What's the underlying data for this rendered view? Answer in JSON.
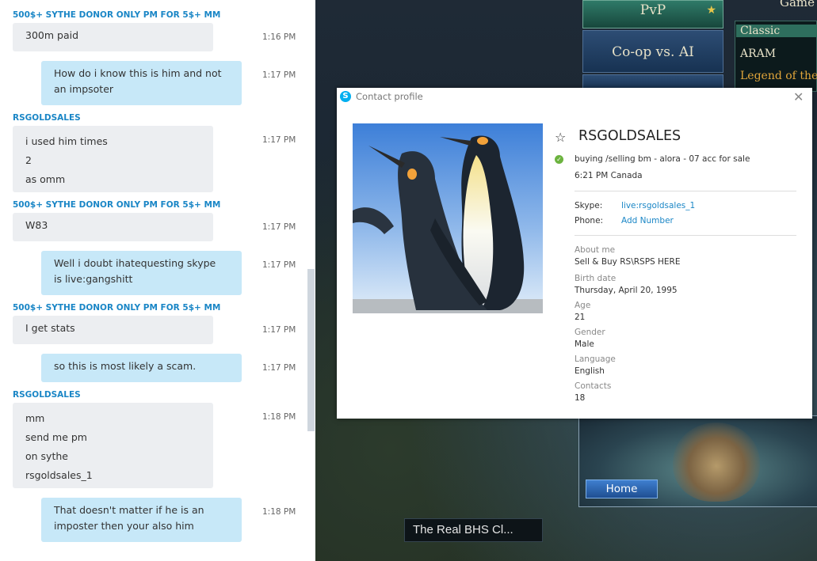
{
  "chat": {
    "messages": [
      {
        "sender": "500$+ SYTHE DONOR ONLY PM FOR 5$+ MM"
      },
      {
        "dir": "in",
        "lines": [
          "300m paid"
        ],
        "time": "1:16 PM"
      },
      {
        "dir": "out",
        "lines": [
          "How do i know this is him and not",
          "an impsoter"
        ],
        "time": "1:17 PM"
      },
      {
        "sender": "RSGOLDSALES"
      },
      {
        "dir": "in",
        "lines": [
          "i used him  times",
          "2",
          "as omm"
        ],
        "time": "1:17 PM"
      },
      {
        "sender": "500$+ SYTHE DONOR ONLY PM FOR 5$+ MM"
      },
      {
        "dir": "in",
        "lines": [
          "W83"
        ],
        "time": "1:17 PM"
      },
      {
        "dir": "out",
        "lines": [
          "Well i doubt ihatequesting skype",
          "is live:gangshitt"
        ],
        "time": "1:17 PM"
      },
      {
        "sender": "500$+ SYTHE DONOR ONLY PM FOR 5$+ MM"
      },
      {
        "dir": "in",
        "lines": [
          "I get stats"
        ],
        "time": "1:17 PM"
      },
      {
        "dir": "out",
        "lines": [
          "so this is most likely a scam."
        ],
        "time": "1:17 PM"
      },
      {
        "sender": "RSGOLDSALES"
      },
      {
        "dir": "in",
        "lines": [
          "mm",
          "send me pm",
          "on sythe",
          "rsgoldsales_1"
        ],
        "time": "1:18 PM"
      },
      {
        "dir": "out",
        "lines": [
          "That doesn't matter if he is an",
          "imposter then your also him"
        ],
        "time": "1:18 PM"
      }
    ]
  },
  "game": {
    "pvp_label": "PvP",
    "game_label": "Game",
    "coop_label": "Co-op vs. AI",
    "modes": [
      "Classic",
      "ARAM",
      "Legend of the"
    ],
    "home_label": "Home",
    "status_text": "The Real BHS Cl..."
  },
  "profile": {
    "dialog_title": "Contact profile",
    "name": "RSGOLDSALES",
    "mood": "buying /selling bm - alora - 07 acc for sale",
    "local_time": "6:21 PM Canada",
    "skype_label": "Skype:",
    "skype_value": "live:rsgoldsales_1",
    "phone_label": "Phone:",
    "phone_value": "Add Number",
    "about": [
      {
        "label": "About me",
        "value": "Sell & Buy RS\\RSPS HERE"
      },
      {
        "label": "Birth date",
        "value": "Thursday, April 20, 1995"
      },
      {
        "label": "Age",
        "value": "21"
      },
      {
        "label": "Gender",
        "value": "Male"
      },
      {
        "label": "Language",
        "value": "English"
      },
      {
        "label": "Contacts",
        "value": "18"
      }
    ]
  }
}
